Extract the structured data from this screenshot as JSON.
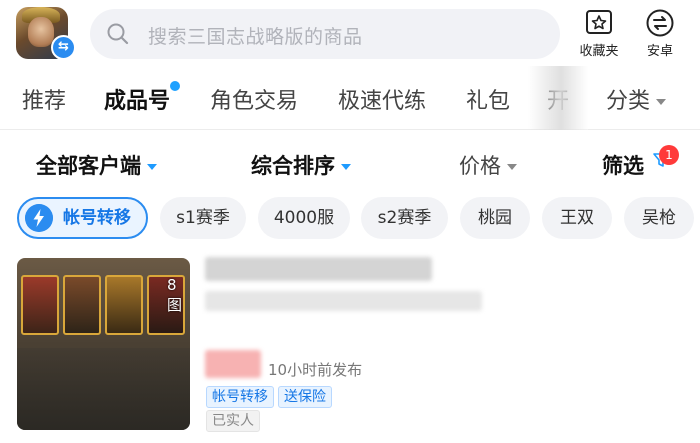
{
  "header": {
    "game_icon": "game-avatar-three-kingdoms",
    "switch_icon": "switch-arrows-icon",
    "search_placeholder": "搜索三国志战略版的商品",
    "favorites_label": "收藏夹",
    "platform_label": "安卓",
    "accent_color": "#2b8cf0"
  },
  "tabs": {
    "items": [
      {
        "label": "推荐"
      },
      {
        "label": "成品号",
        "active": true
      },
      {
        "label": "角色交易"
      },
      {
        "label": "极速代练"
      },
      {
        "label": "礼包"
      },
      {
        "label": "开"
      }
    ],
    "category_label": "分类"
  },
  "filters": {
    "client": "全部客户端",
    "sort": "综合排序",
    "price": "价格",
    "screen": "筛选",
    "screen_badge": "1",
    "badge_color": "#ff3a3a"
  },
  "chips": {
    "primary": "帐号转移",
    "items": [
      "s1赛季",
      "4000服",
      "s2赛季",
      "桃园",
      "王双",
      "吴枪"
    ]
  },
  "product": {
    "image_count": "8图",
    "publish_time": "10小时前发布",
    "tags": [
      "帐号转移",
      "送保险"
    ],
    "verified_tag": "已实人"
  }
}
